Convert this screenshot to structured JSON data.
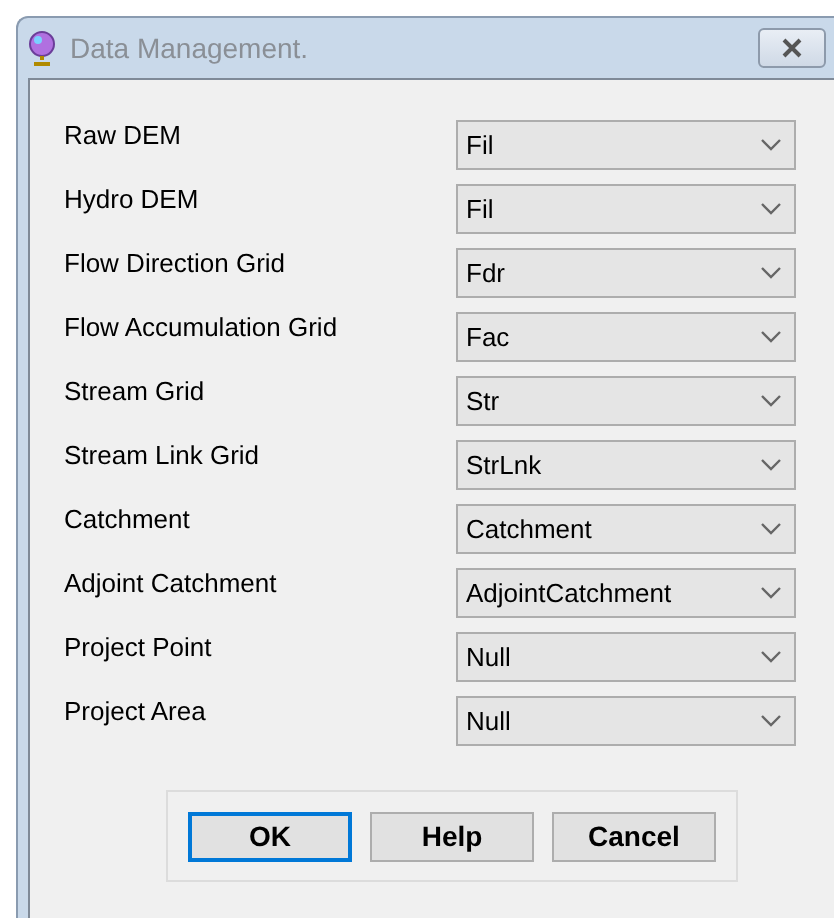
{
  "window": {
    "title": "Data Management."
  },
  "fields": [
    {
      "label": "Raw DEM",
      "value": "Fil"
    },
    {
      "label": "Hydro DEM",
      "value": "Fil"
    },
    {
      "label": "Flow Direction Grid",
      "value": "Fdr"
    },
    {
      "label": "Flow Accumulation Grid",
      "value": "Fac"
    },
    {
      "label": "Stream Grid",
      "value": "Str"
    },
    {
      "label": "Stream Link Grid",
      "value": "StrLnk"
    },
    {
      "label": "Catchment",
      "value": "Catchment"
    },
    {
      "label": "Adjoint Catchment",
      "value": "AdjointCatchment"
    },
    {
      "label": "Project Point",
      "value": "Null"
    },
    {
      "label": "Project Area",
      "value": "Null"
    }
  ],
  "buttons": [
    {
      "label": "OK",
      "selected": true
    },
    {
      "label": "Help",
      "selected": false
    },
    {
      "label": "Cancel",
      "selected": false
    }
  ]
}
